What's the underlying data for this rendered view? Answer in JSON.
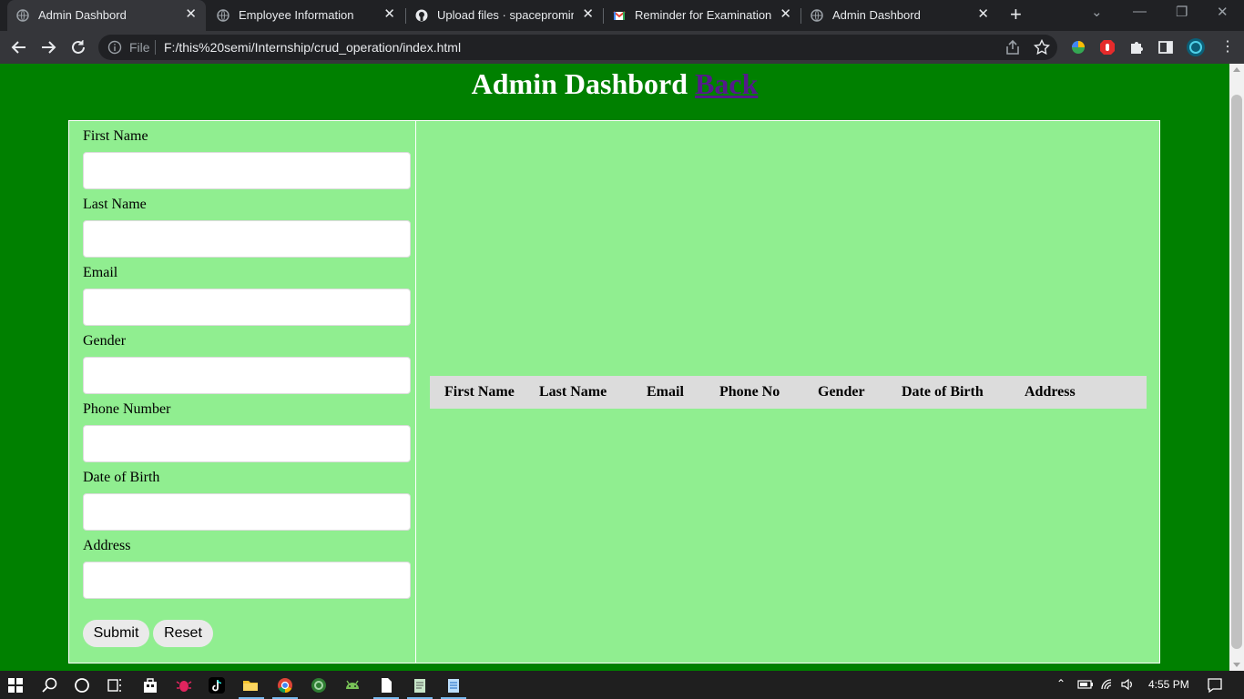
{
  "browser": {
    "tabs": [
      {
        "title": "Admin Dashbord",
        "icon": "globe-icon",
        "active": true
      },
      {
        "title": "Employee Information",
        "icon": "globe-icon",
        "active": false
      },
      {
        "title": "Upload files · spacepromin/O",
        "icon": "github-icon",
        "active": false
      },
      {
        "title": "Reminder for Examination - a",
        "icon": "gmail-icon",
        "active": false
      },
      {
        "title": "Admin Dashbord",
        "icon": "globe-icon",
        "active": false
      }
    ],
    "omnibox": {
      "scheme_label": "File",
      "url": "F:/this%20semi/Internship/crud_operation/index.html"
    }
  },
  "page": {
    "heading": "Admin Dashbord",
    "back_link": "Back",
    "background_color": "#008000",
    "panel_color": "#90ee90",
    "form": {
      "fields": [
        {
          "label": "First Name",
          "value": ""
        },
        {
          "label": "Last Name",
          "value": ""
        },
        {
          "label": "Email",
          "value": ""
        },
        {
          "label": "Gender",
          "value": ""
        },
        {
          "label": "Phone Number",
          "value": ""
        },
        {
          "label": "Date of Birth",
          "value": ""
        },
        {
          "label": "Address",
          "value": ""
        }
      ],
      "submit_label": "Submit",
      "reset_label": "Reset"
    },
    "table": {
      "columns": [
        "First Name",
        "Last Name",
        "Email",
        "Phone No",
        "Gender",
        "Date of Birth",
        "Address"
      ],
      "rows": []
    }
  },
  "taskbar": {
    "clock": "4:55 PM"
  }
}
